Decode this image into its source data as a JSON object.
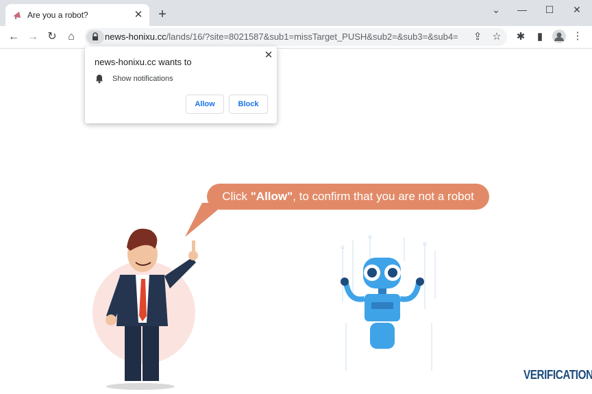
{
  "tab": {
    "title": "Are you a robot?",
    "close": "✕"
  },
  "newtab": "+",
  "window": {
    "minimize": "⌄",
    "restore": "—",
    "maximize": "☐",
    "close": "✕"
  },
  "toolbar": {
    "back": "←",
    "forward": "→",
    "reload": "↻",
    "home": "⌂",
    "url_host": "news-honixu.cc",
    "url_path": "/lands/16/?site=8021587&sub1=missTarget_PUSH&sub2=&sub3=&sub4=",
    "share": "⇪",
    "star": "☆",
    "extensions": "✱",
    "sidepanel": "▮"
  },
  "popup": {
    "title": "news-honixu.cc wants to",
    "close": "✕",
    "item": "Show notifications",
    "allow": "Allow",
    "block": "Block"
  },
  "page": {
    "bubble_prefix": "Click ",
    "bubble_bold": "\"Allow\"",
    "bubble_suffix": ", to confirm that you are not a robot",
    "verification": "VERIFICATION"
  },
  "colors": {
    "bubble": "#e28a68",
    "link": "#1a73e8",
    "verification": "#1d4b7e",
    "robot": "#3fa3e8"
  }
}
